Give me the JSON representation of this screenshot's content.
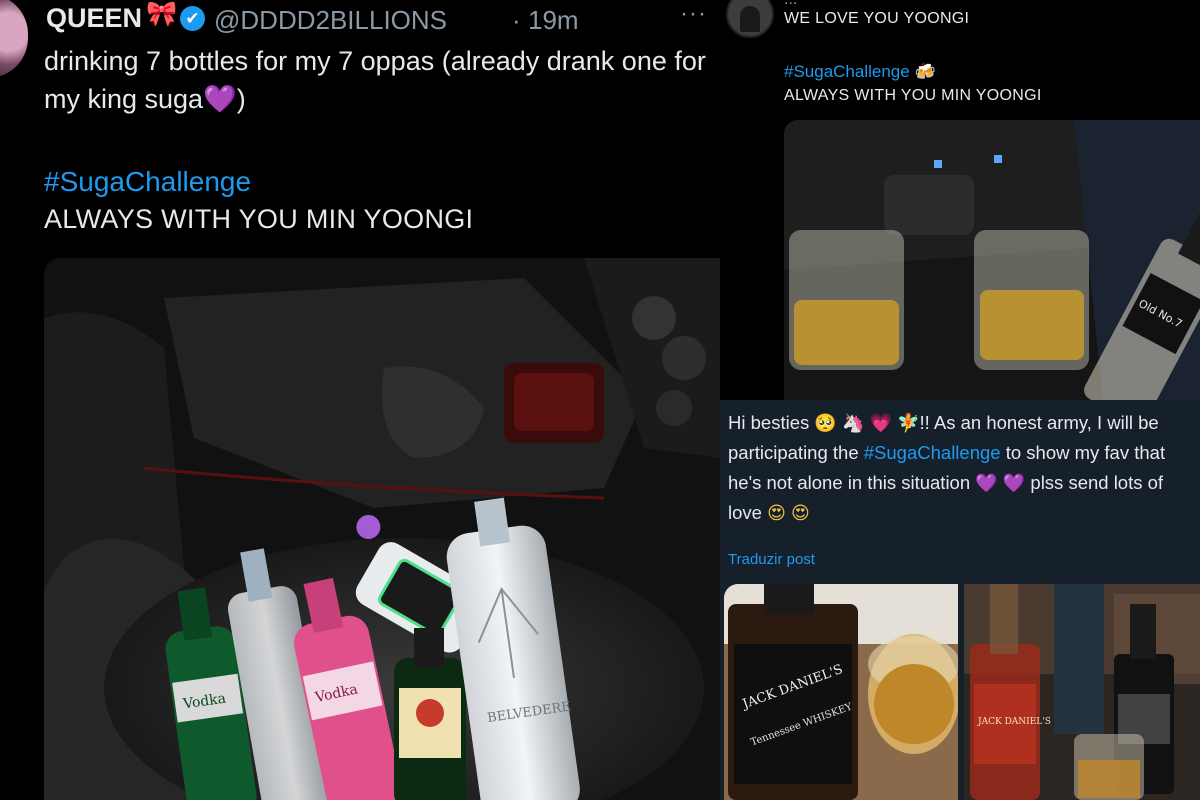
{
  "left_tweet": {
    "name": "QUEEN",
    "name_emoji": "🎀",
    "verified_icon": "✔",
    "handle": "@DDDD2BILLIONS",
    "separator": "·",
    "time": "19m",
    "more_icon": "···",
    "body_text": "drinking 7 bottles for my 7 oppas (already drank one for my king suga",
    "body_emoji": "💜",
    "body_close": ")",
    "hashtag": "#SugaChallenge",
    "tagline": "ALWAYS WITH YOU MIN YOONGI",
    "photo_labels": {
      "vodka_left": "Vodka",
      "vodka_pink": "Vodka",
      "belvedere": "BELVEDERE"
    }
  },
  "right_top_tweet": {
    "truncated_header": "...",
    "message": "WE LOVE YOU YOONGI",
    "hashtag": "#SugaChallenge",
    "hashtag_emoji": "🍻",
    "tagline": "ALWAYS WITH YOU MIN YOONGI",
    "photo_labels": {
      "bottle": "Old No.7"
    }
  },
  "right_bottom_post": {
    "text_part1": "Hi besties",
    "emojis_1": [
      "🥺",
      "🦄",
      "💗",
      "🧚"
    ],
    "text_part2": "!! As an honest army, I will be participating the ",
    "hashtag": "#SugaChallenge",
    "text_part3": " to show my fav that he's not alone in this situation ",
    "emojis_2": [
      "💜",
      "💜"
    ],
    "text_part4": " plss send lots of love ",
    "emojis_3": [
      "😍",
      "😍"
    ],
    "translate_link": "Traduzir post",
    "photo_labels": {
      "jack1": "JACK DANIEL'S",
      "jack1_sub": "Tennessee WHISKEY",
      "jack2": "JACK DANIEL'S"
    }
  },
  "colors": {
    "link_blue": "#1d9bf0",
    "text_primary": "#e7e9ea",
    "text_secondary": "#8b98a5",
    "dim_bg": "#15202b",
    "purple_heart": "#a64dff"
  }
}
